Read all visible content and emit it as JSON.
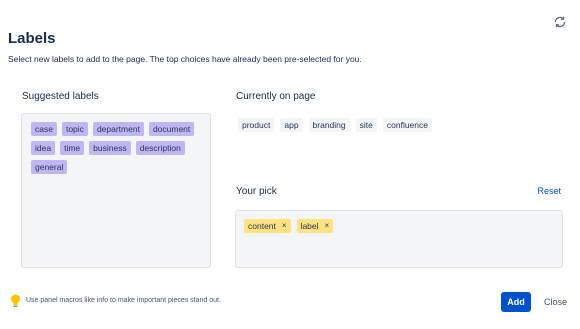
{
  "header": {
    "title": "Labels",
    "subtitle": "Select new labels to add to the page. The top choices have already been pre-selected for you.",
    "refresh_icon": "refresh-icon"
  },
  "suggested": {
    "label": "Suggested labels",
    "items": [
      "case",
      "topic",
      "department",
      "document",
      "idea",
      "time",
      "business",
      "description",
      "general"
    ]
  },
  "current": {
    "label": "Currently on page",
    "items": [
      "product",
      "app",
      "branding",
      "site",
      "confluence"
    ]
  },
  "pick": {
    "label": "Your pick",
    "reset_label": "Reset",
    "items": [
      "content",
      "label"
    ],
    "remove_glyph": "×"
  },
  "footer": {
    "tip_icon": "lightbulb-icon",
    "tip": "Use panel macros like info to make important pieces stand out.",
    "add_label": "Add",
    "close_label": "Close"
  },
  "colors": {
    "suggested_chip": "#c0b6f2",
    "pick_chip": "#ffe380",
    "primary": "#0052cc"
  }
}
